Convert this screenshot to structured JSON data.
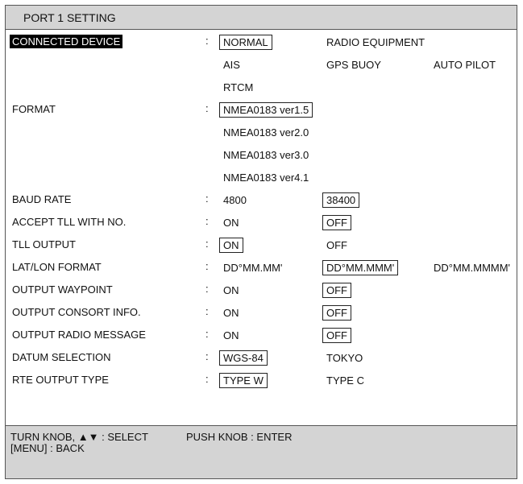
{
  "title": "PORT 1 SETTING",
  "colon": ":",
  "settings": {
    "connected_device": {
      "label": "CONNECTED DEVICE",
      "options": [
        "NORMAL",
        "RADIO EQUIPMENT",
        "AIS",
        "GPS BUOY",
        "AUTO PILOT",
        "RTCM"
      ],
      "selected": "NORMAL"
    },
    "format": {
      "label": "FORMAT",
      "options": [
        "NMEA0183 ver1.5",
        "NMEA0183 ver2.0",
        "NMEA0183 ver3.0",
        "NMEA0183 ver4.1"
      ],
      "selected": "NMEA0183 ver1.5"
    },
    "baud_rate": {
      "label": "BAUD RATE",
      "options": [
        "4800",
        "38400"
      ],
      "selected": "38400"
    },
    "accept_tll": {
      "label": "ACCEPT TLL WITH NO.",
      "options": [
        "ON",
        "OFF"
      ],
      "selected": "OFF"
    },
    "tll_output": {
      "label": "TLL OUTPUT",
      "options": [
        "ON",
        "OFF"
      ],
      "selected": "ON"
    },
    "latlon_format": {
      "label": "LAT/LON FORMAT",
      "options": [
        "DD°MM.MM'",
        "DD°MM.MMM'",
        "DD°MM.MMMM'"
      ],
      "selected": "DD°MM.MMM'"
    },
    "output_waypoint": {
      "label": "OUTPUT WAYPOINT",
      "options": [
        "ON",
        "OFF"
      ],
      "selected": "OFF"
    },
    "output_consort": {
      "label": "OUTPUT CONSORT INFO.",
      "options": [
        "ON",
        "OFF"
      ],
      "selected": "OFF"
    },
    "output_radio": {
      "label": "OUTPUT RADIO MESSAGE",
      "options": [
        "ON",
        "OFF"
      ],
      "selected": "OFF"
    },
    "datum": {
      "label": "DATUM SELECTION",
      "options": [
        "WGS-84",
        "TOKYO"
      ],
      "selected": "WGS-84"
    },
    "rte_output": {
      "label": "RTE OUTPUT TYPE",
      "options": [
        "TYPE W",
        "TYPE C"
      ],
      "selected": "TYPE W"
    }
  },
  "footer": {
    "select_hint": "TURN KNOB, ▲▼ : SELECT",
    "enter_hint": "PUSH KNOB : ENTER",
    "back_hint": "[MENU] : BACK"
  }
}
